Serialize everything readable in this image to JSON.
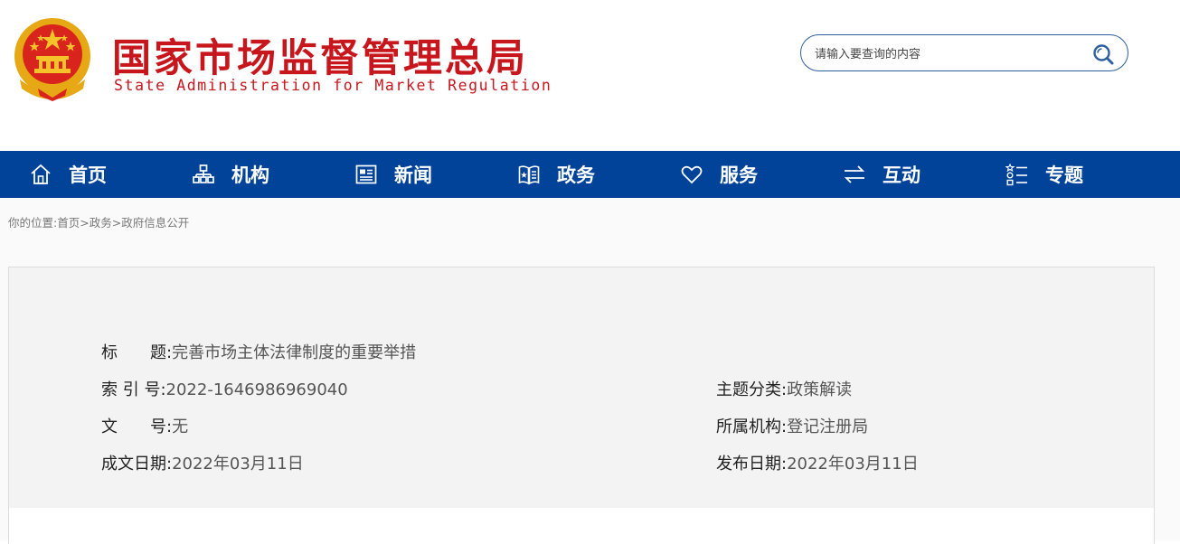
{
  "header": {
    "title_cn": "国家市场监督管理总局",
    "title_en": "State Administration for Market Regulation",
    "search_placeholder": "请输入要查询的内容"
  },
  "nav": [
    {
      "label": "首页",
      "icon": "home-icon"
    },
    {
      "label": "机构",
      "icon": "org-chart-icon"
    },
    {
      "label": "新闻",
      "icon": "news-icon"
    },
    {
      "label": "政务",
      "icon": "government-affairs-icon"
    },
    {
      "label": "服务",
      "icon": "heart-icon"
    },
    {
      "label": "互动",
      "icon": "exchange-arrows-icon"
    },
    {
      "label": "专题",
      "icon": "topics-list-icon"
    }
  ],
  "breadcrumb": {
    "prefix": "你的位置:",
    "items": [
      "首页",
      "政务",
      "政府信息公开"
    ],
    "separator": ">"
  },
  "doc": {
    "title_label": "标　　题:",
    "title_value": "完善市场主体法律制度的重要举措",
    "index_label": "索 引 号:",
    "index_value": "2022-1646986969040",
    "docno_label": "文　　号:",
    "docno_value": "无",
    "date_label": "成文日期:",
    "date_value": "2022年03月11日",
    "category_label": "主题分类:",
    "category_value": "政策解读",
    "agency_label": "所属机构:",
    "agency_value": "登记注册局",
    "publish_label": "发布日期:",
    "publish_value": "2022年03月11日"
  },
  "colors": {
    "brand_red": "#c8161d",
    "nav_blue": "#014399",
    "search_border": "#2f5f9e"
  }
}
